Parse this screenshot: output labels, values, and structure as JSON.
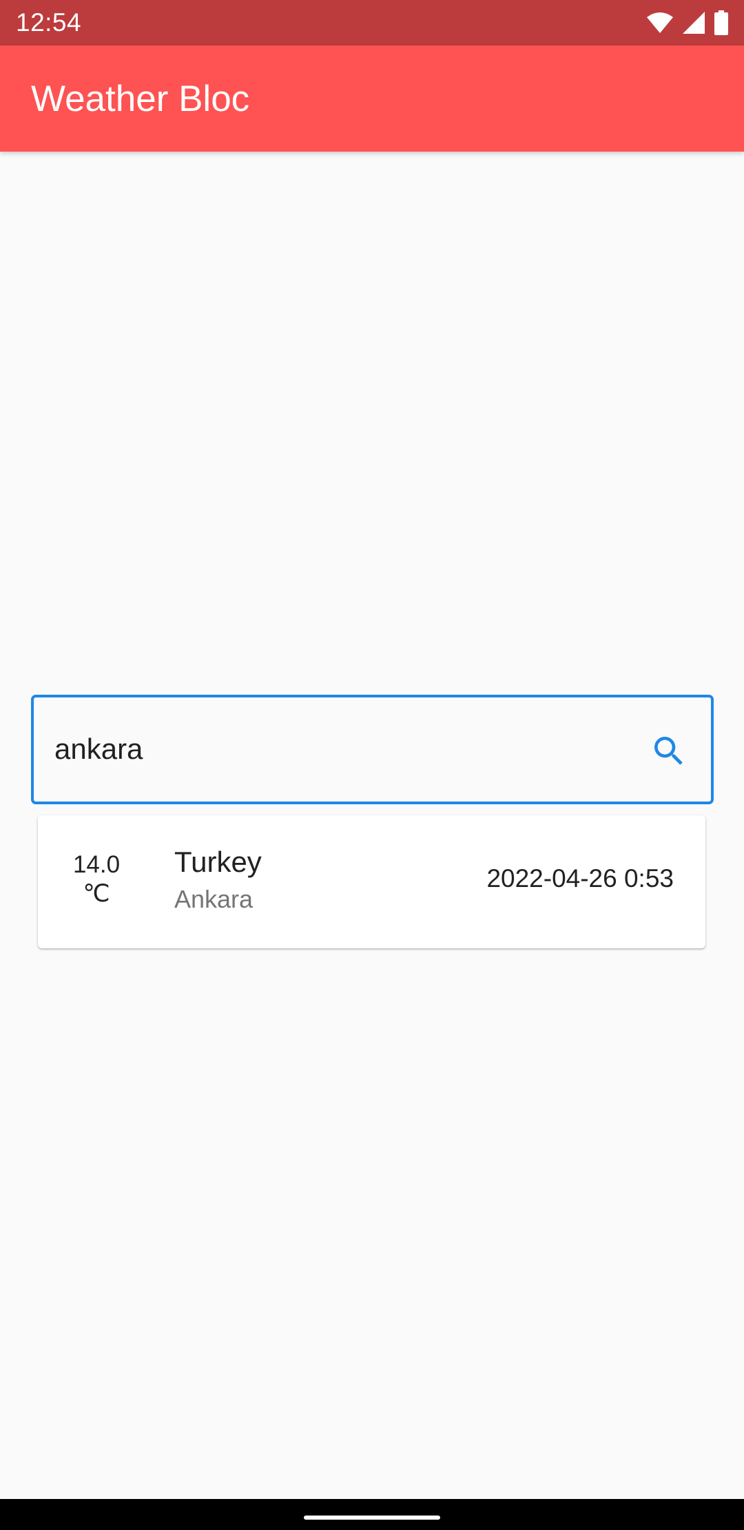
{
  "status_bar": {
    "time": "12:54",
    "icons": [
      "wifi-icon",
      "signal-icon",
      "battery-icon"
    ]
  },
  "app_bar": {
    "title": "Weather Bloc",
    "color": "#fe5352"
  },
  "search": {
    "value": "ankara",
    "icon": "search-icon",
    "accent_color": "#1e88e5"
  },
  "results": [
    {
      "temperature": "14.0",
      "unit": "℃",
      "country": "Turkey",
      "city": "Ankara",
      "datetime": "2022-04-26 0:53"
    }
  ]
}
